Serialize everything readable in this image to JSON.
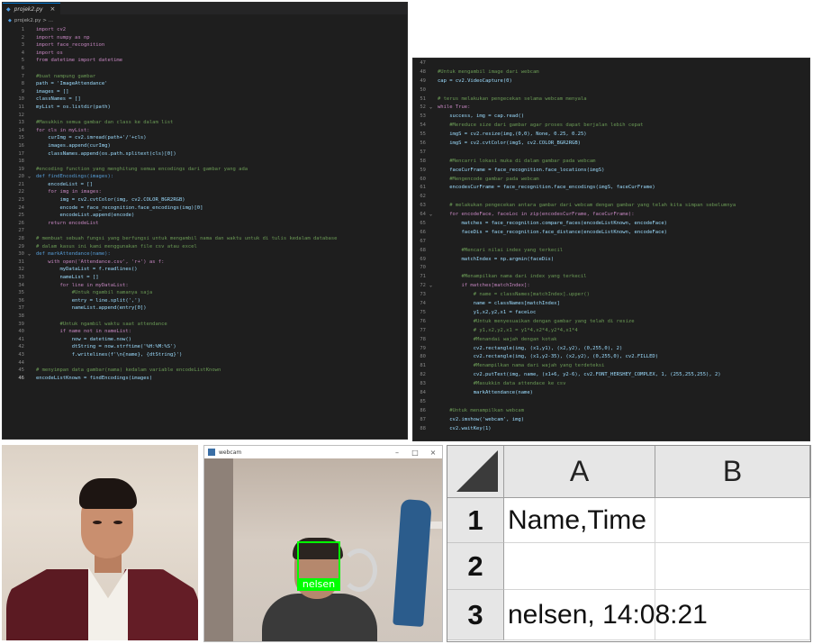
{
  "editor1": {
    "tab_title": "projek2.py",
    "tab_icon": "python-file-icon",
    "close_glyph": "×",
    "breadcrumb": "projek2.py > ...",
    "lines": [
      {
        "n": "1",
        "t": "import cv2",
        "c": "#c586c0"
      },
      {
        "n": "2",
        "t": "import numpy as np",
        "c": "#c586c0"
      },
      {
        "n": "3",
        "t": "import face_recognition",
        "c": "#c586c0"
      },
      {
        "n": "4",
        "t": "import os",
        "c": "#c586c0"
      },
      {
        "n": "5",
        "t": "from datetime import datetime",
        "c": "#c586c0"
      },
      {
        "n": "6",
        "t": "",
        "c": "#d4d4d4"
      },
      {
        "n": "7",
        "t": "#buat nampung gambar",
        "c": "#6a9955"
      },
      {
        "n": "8",
        "t": "path = 'ImageAttendance'",
        "c": "#9cdcfe"
      },
      {
        "n": "9",
        "t": "images = []",
        "c": "#9cdcfe"
      },
      {
        "n": "10",
        "t": "classNames = []",
        "c": "#9cdcfe"
      },
      {
        "n": "11",
        "t": "myList = os.listdir(path)",
        "c": "#9cdcfe"
      },
      {
        "n": "12",
        "t": "",
        "c": "#d4d4d4"
      },
      {
        "n": "13",
        "t": "#Masukkin semua gambar dan class ke dalam list",
        "c": "#6a9955"
      },
      {
        "n": "14",
        "t": "for cls in myList:",
        "c": "#c586c0"
      },
      {
        "n": "15",
        "t": "    curImg = cv2.imread(path+'/'+cls)",
        "c": "#9cdcfe"
      },
      {
        "n": "16",
        "t": "    images.append(curImg)",
        "c": "#9cdcfe"
      },
      {
        "n": "17",
        "t": "    classNames.append(os.path.splitext(cls)[0])",
        "c": "#9cdcfe"
      },
      {
        "n": "18",
        "t": "",
        "c": "#d4d4d4"
      },
      {
        "n": "19",
        "t": "#encoding function yang menghitung semua encodings dari gambar yang ada",
        "c": "#6a9955"
      },
      {
        "n": "20",
        "t": "def findEncodings(images):",
        "c": "#569cd6",
        "fold": "v"
      },
      {
        "n": "21",
        "t": "    encodeList = []",
        "c": "#9cdcfe"
      },
      {
        "n": "22",
        "t": "    for img in images:",
        "c": "#c586c0"
      },
      {
        "n": "23",
        "t": "        img = cv2.cvtColor(img, cv2.COLOR_BGR2RGB)",
        "c": "#9cdcfe"
      },
      {
        "n": "24",
        "t": "        encode = face_recognition.face_encodings(img)[0]",
        "c": "#9cdcfe"
      },
      {
        "n": "25",
        "t": "        encodeList.append(encode)",
        "c": "#9cdcfe"
      },
      {
        "n": "26",
        "t": "    return encodeList",
        "c": "#c586c0"
      },
      {
        "n": "27",
        "t": "",
        "c": "#d4d4d4"
      },
      {
        "n": "28",
        "t": "# membuat sebuah fungsi yang berfungsi untuk mengambil nama dan waktu untuk di tulis kedalam database",
        "c": "#6a9955"
      },
      {
        "n": "29",
        "t": "# dalam kasus ini kami menggunakan file csv atau excel",
        "c": "#6a9955"
      },
      {
        "n": "30",
        "t": "def markAttendance(name):",
        "c": "#569cd6",
        "fold": "v"
      },
      {
        "n": "31",
        "t": "    with open('Attendance.csv', 'r+') as f:",
        "c": "#c586c0"
      },
      {
        "n": "32",
        "t": "        myDataList = f.readlines()",
        "c": "#9cdcfe"
      },
      {
        "n": "33",
        "t": "        nameList = []",
        "c": "#9cdcfe"
      },
      {
        "n": "34",
        "t": "        for line in myDataList:",
        "c": "#c586c0"
      },
      {
        "n": "35",
        "t": "            #Untuk ngambil namanya saja",
        "c": "#6a9955"
      },
      {
        "n": "36",
        "t": "            entry = line.split(',')",
        "c": "#9cdcfe"
      },
      {
        "n": "37",
        "t": "            nameList.append(entry[0])",
        "c": "#9cdcfe"
      },
      {
        "n": "38",
        "t": "",
        "c": "#d4d4d4"
      },
      {
        "n": "39",
        "t": "        #Untuk ngambil waktu saat attendance",
        "c": "#6a9955"
      },
      {
        "n": "40",
        "t": "        if name not in nameList:",
        "c": "#c586c0"
      },
      {
        "n": "41",
        "t": "            now = datetime.now()",
        "c": "#9cdcfe"
      },
      {
        "n": "42",
        "t": "            dtString = now.strftime('%H:%M:%S')",
        "c": "#9cdcfe"
      },
      {
        "n": "43",
        "t": "            f.writelines(f'\\n{name}, {dtString}')",
        "c": "#9cdcfe"
      },
      {
        "n": "44",
        "t": "",
        "c": "#d4d4d4"
      },
      {
        "n": "45",
        "t": "# menyimpan data gambar(nama) kedalam variable encodeListKnown",
        "c": "#6a9955"
      },
      {
        "n": "46",
        "t": "encodeListKnown = findEncodings(images)",
        "c": "#9cdcfe",
        "active": true
      }
    ]
  },
  "editor2": {
    "lines": [
      {
        "n": "47",
        "t": "",
        "c": "#d4d4d4"
      },
      {
        "n": "48",
        "t": "#Untuk mengambil image dari webcam",
        "c": "#6a9955"
      },
      {
        "n": "49",
        "t": "cap = cv2.VideoCapture(0)",
        "c": "#9cdcfe"
      },
      {
        "n": "50",
        "t": "",
        "c": "#d4d4d4"
      },
      {
        "n": "51",
        "t": "# terus melakukan pengecekan selama webcam menyala",
        "c": "#6a9955"
      },
      {
        "n": "52",
        "t": "while True:",
        "c": "#c586c0",
        "fold": "v"
      },
      {
        "n": "53",
        "t": "    success, img = cap.read()",
        "c": "#9cdcfe"
      },
      {
        "n": "54",
        "t": "    #Mereduce size dari gambar agar proses dapat berjalan lebih cepat",
        "c": "#6a9955"
      },
      {
        "n": "55",
        "t": "    imgS = cv2.resize(img,(0,0), None, 0.25, 0.25)",
        "c": "#9cdcfe"
      },
      {
        "n": "56",
        "t": "    imgS = cv2.cvtColor(imgS, cv2.COLOR_BGR2RGB)",
        "c": "#9cdcfe"
      },
      {
        "n": "57",
        "t": "",
        "c": "#d4d4d4"
      },
      {
        "n": "58",
        "t": "    #Mencarri lokasi muka di dalam gambar pada webcam",
        "c": "#6a9955"
      },
      {
        "n": "59",
        "t": "    faceCurFrame = face_recognition.face_locations(imgS)",
        "c": "#9cdcfe"
      },
      {
        "n": "60",
        "t": "    #Mengencode gambar pada webcam",
        "c": "#6a9955"
      },
      {
        "n": "61",
        "t": "    encodesCurFrame = face_recognition.face_encodings(imgS, faceCurFrame)",
        "c": "#9cdcfe"
      },
      {
        "n": "62",
        "t": "",
        "c": "#d4d4d4"
      },
      {
        "n": "63",
        "t": "    # melakukan pengecekan antara gambar dari webcam dengan gambar yang telah kita simpan sebelumnya",
        "c": "#6a9955"
      },
      {
        "n": "64",
        "t": "    for encodeFace, faceLoc in zip(encodesCurFrame, faceCurFrame):",
        "c": "#c586c0",
        "fold": "v"
      },
      {
        "n": "65",
        "t": "        matches = face_recognition.compare_faces(encodeListKnown, encodeFace)",
        "c": "#9cdcfe"
      },
      {
        "n": "66",
        "t": "        faceDis = face_recognition.face_distance(encodeListKnown, encodeFace)",
        "c": "#9cdcfe"
      },
      {
        "n": "67",
        "t": "",
        "c": "#d4d4d4"
      },
      {
        "n": "68",
        "t": "        #Mencari nilai index yang terkecil",
        "c": "#6a9955"
      },
      {
        "n": "69",
        "t": "        matchIndex = np.argmin(faceDis)",
        "c": "#9cdcfe"
      },
      {
        "n": "70",
        "t": "",
        "c": "#d4d4d4"
      },
      {
        "n": "71",
        "t": "        #Menampilkan nama dari index yang terkecil",
        "c": "#6a9955"
      },
      {
        "n": "72",
        "t": "        if matches[matchIndex]:",
        "c": "#c586c0",
        "fold": "v"
      },
      {
        "n": "73",
        "t": "            # name = classNames[matchIndex].upper()",
        "c": "#6a9955"
      },
      {
        "n": "74",
        "t": "            name = classNames[matchIndex]",
        "c": "#9cdcfe"
      },
      {
        "n": "75",
        "t": "            y1,x2,y2,x1 = faceLoc",
        "c": "#9cdcfe"
      },
      {
        "n": "76",
        "t": "            #Untuk menyesuaikan dengan gambar yang telah di resize",
        "c": "#6a9955"
      },
      {
        "n": "77",
        "t": "            # y1,x2,y2,x1 = y1*4,x2*4,y2*4,x1*4",
        "c": "#6a9955"
      },
      {
        "n": "78",
        "t": "            #Menandai wajah dengan kotak",
        "c": "#6a9955"
      },
      {
        "n": "79",
        "t": "            cv2.rectangle(img, (x1,y1), (x2,y2), (0,255,0), 2)",
        "c": "#9cdcfe"
      },
      {
        "n": "80",
        "t": "            cv2.rectangle(img, (x1,y2-35), (x2,y2), (0,255,0), cv2.FILLED)",
        "c": "#9cdcfe"
      },
      {
        "n": "81",
        "t": "            #Menampilkan nama dari wajah yang terdeteksi",
        "c": "#6a9955"
      },
      {
        "n": "82",
        "t": "            cv2.putText(img, name, (x1+6, y2-6), cv2.FONT_HERSHEY_COMPLEX, 1, (255,255,255), 2)",
        "c": "#9cdcfe"
      },
      {
        "n": "83",
        "t": "            #Masukkin data attendace ke csv",
        "c": "#6a9955"
      },
      {
        "n": "84",
        "t": "            markAttendance(name)",
        "c": "#9cdcfe"
      },
      {
        "n": "85",
        "t": "",
        "c": "#d4d4d4"
      },
      {
        "n": "86",
        "t": "    #Untuk menampilkan webcam",
        "c": "#6a9955"
      },
      {
        "n": "87",
        "t": "    cv2.imshow('webcam', img)",
        "c": "#9cdcfe"
      },
      {
        "n": "88",
        "t": "    cv2.waitKey(1)",
        "c": "#9cdcfe"
      }
    ]
  },
  "webcam": {
    "title": "webcam",
    "minimize": "–",
    "maximize": "□",
    "close": "×",
    "face_label": "nelsen",
    "box_color": "#00ff00"
  },
  "excel": {
    "columns": [
      "A",
      "B"
    ],
    "rows": [
      {
        "num": "1",
        "a": "Name,Time",
        "b": ""
      },
      {
        "num": "2",
        "a": "",
        "b": ""
      },
      {
        "num": "3",
        "a": "nelsen, 14:08:21",
        "b": ""
      }
    ]
  },
  "colors": {
    "editor_bg": "#1e1e1e",
    "comment": "#6a9955",
    "keyword": "#c586c0",
    "variable": "#9cdcfe",
    "detection_green": "#00ff00"
  }
}
